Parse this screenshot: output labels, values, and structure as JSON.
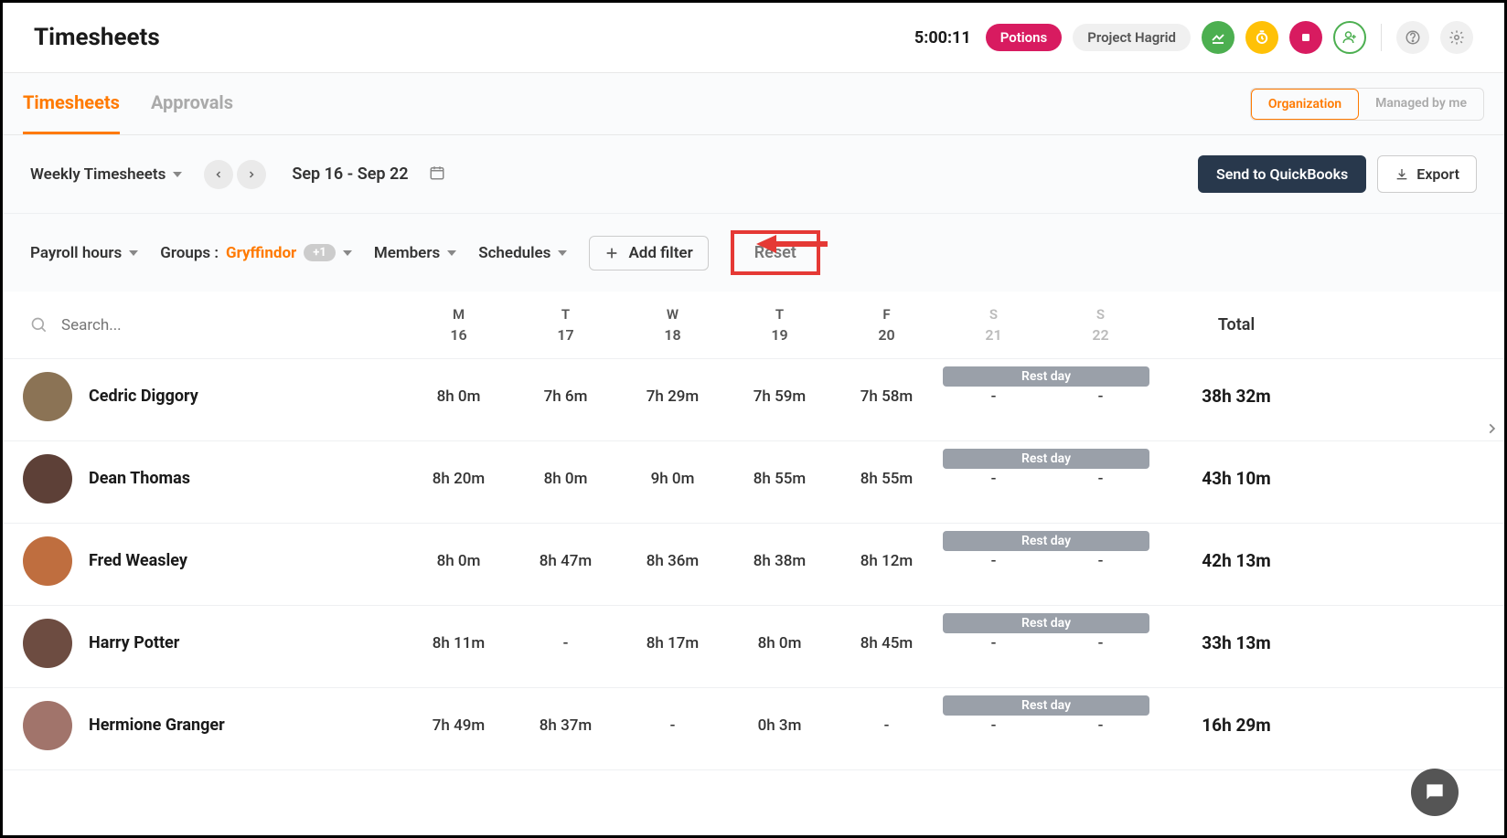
{
  "header": {
    "title": "Timesheets",
    "timer": "5:00:11",
    "task_pill": "Potions",
    "project_pill": "Project Hagrid"
  },
  "tabs": {
    "left": [
      "Timesheets",
      "Approvals"
    ],
    "active_index": 0,
    "view_toggle": [
      "Organization",
      "Managed by me"
    ],
    "view_active": 0
  },
  "toolbar": {
    "view_label": "Weekly Timesheets",
    "date_range": "Sep 16 - Sep 22",
    "quickbooks_btn": "Send to QuickBooks",
    "export_btn": "Export"
  },
  "filters": {
    "payroll": "Payroll hours",
    "groups_label": "Groups",
    "groups_value": "Gryffindor",
    "groups_extra": "+1",
    "members": "Members",
    "schedules": "Schedules",
    "add_filter": "Add filter",
    "reset": "Reset"
  },
  "table": {
    "search_placeholder": "Search...",
    "days": [
      {
        "label": "M",
        "num": "16",
        "weekend": false
      },
      {
        "label": "T",
        "num": "17",
        "weekend": false
      },
      {
        "label": "W",
        "num": "18",
        "weekend": false
      },
      {
        "label": "T",
        "num": "19",
        "weekend": false
      },
      {
        "label": "F",
        "num": "20",
        "weekend": false
      },
      {
        "label": "S",
        "num": "21",
        "weekend": true
      },
      {
        "label": "S",
        "num": "22",
        "weekend": true
      }
    ],
    "total_label": "Total",
    "rest_label": "Rest day",
    "rows": [
      {
        "name": "Cedric Diggory",
        "times": [
          "8h 0m",
          "7h 6m",
          "7h 29m",
          "7h 59m",
          "7h 58m",
          "-",
          "-"
        ],
        "total": "38h 32m",
        "avatar_bg": "#8b7355"
      },
      {
        "name": "Dean Thomas",
        "times": [
          "8h 20m",
          "8h 0m",
          "9h 0m",
          "8h 55m",
          "8h 55m",
          "-",
          "-"
        ],
        "total": "43h 10m",
        "avatar_bg": "#5d4037"
      },
      {
        "name": "Fred Weasley",
        "times": [
          "8h 0m",
          "8h 47m",
          "8h 36m",
          "8h 38m",
          "8h 12m",
          "-",
          "-"
        ],
        "total": "42h 13m",
        "avatar_bg": "#bf6e3f"
      },
      {
        "name": "Harry Potter",
        "times": [
          "8h 11m",
          "-",
          "8h 17m",
          "8h 0m",
          "8h 45m",
          "-",
          "-"
        ],
        "total": "33h 13m",
        "avatar_bg": "#6d4c41"
      },
      {
        "name": "Hermione Granger",
        "times": [
          "7h 49m",
          "8h 37m",
          "-",
          "0h 3m",
          "-",
          "-",
          "-"
        ],
        "total": "16h 29m",
        "avatar_bg": "#a1746b"
      }
    ]
  }
}
